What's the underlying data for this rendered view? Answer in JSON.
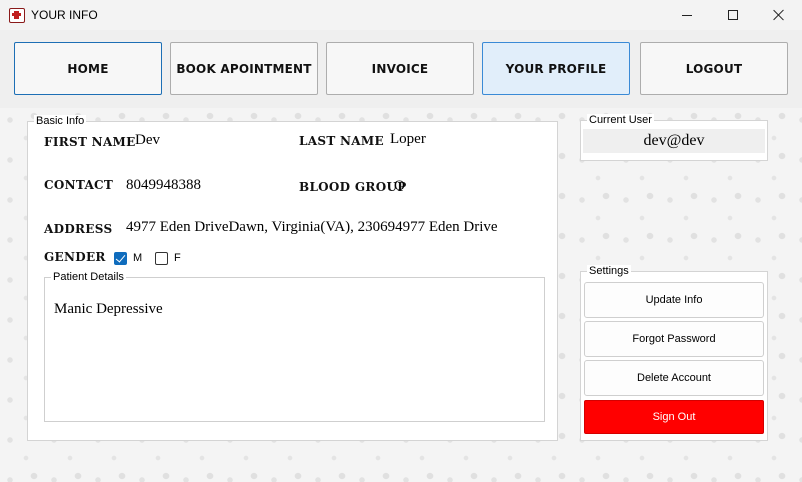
{
  "window": {
    "title": "YOUR INFO",
    "icon": "medical-kit-icon"
  },
  "nav": {
    "home": "HOME",
    "book": "BOOK APOINTMENT",
    "invoice": "INVOICE",
    "profile": "YOUR PROFILE",
    "logout": "LOGOUT"
  },
  "basic_info": {
    "legend": "Basic Info",
    "first_name_label": "FIRST NAME",
    "first_name": "Dev",
    "last_name_label": "LAST NAME",
    "last_name": "Loper",
    "contact_label": "CONTACT",
    "contact": "8049948388",
    "blood_group_label": "BLOOD GROUP",
    "blood_group": "O",
    "address_label": "ADDRESS",
    "address": "4977 Eden DriveDawn, Virginia(VA), 230694977 Eden Drive",
    "gender_label": "GENDER",
    "gender_m": "M",
    "gender_f": "F",
    "gender_m_checked": true,
    "gender_f_checked": false,
    "patient_details_legend": "Patient Details",
    "patient_details": "Manic Depressive"
  },
  "current_user": {
    "legend": "Current User",
    "value": "dev@dev"
  },
  "settings": {
    "legend": "Settings",
    "update": "Update Info",
    "forgot": "Forgot Password",
    "delete": "Delete Account",
    "signout": "Sign Out"
  },
  "colors": {
    "accent": "#0f6cbd",
    "signout_bg": "#ff0000",
    "profile_active_bg": "#e1eefa"
  }
}
